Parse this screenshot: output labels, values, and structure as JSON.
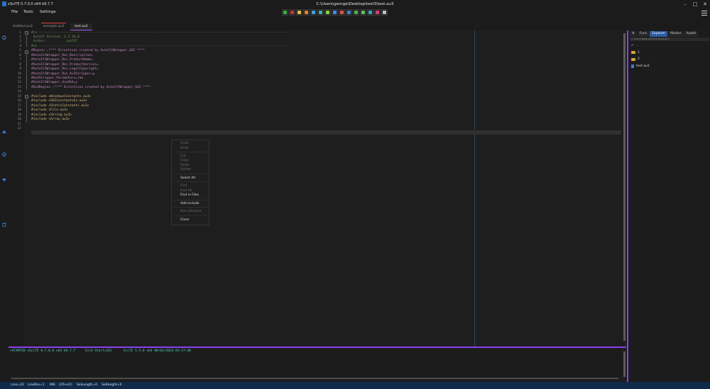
{
  "window": {
    "app_title": "xSciTE 0.7.0.0 x64 b9.7.7",
    "title": "C:\\Users\\george\\Desktop\\test3\\test.au3"
  },
  "menu": [
    "File",
    "Tools",
    "Settings"
  ],
  "toolbar": {
    "icons": [
      {
        "name": "run-icon",
        "color": "#3cb043"
      },
      {
        "name": "stop-icon",
        "color": "#d03030"
      },
      {
        "name": "compile-icon",
        "color": "#e0c040"
      },
      {
        "name": "build-icon",
        "color": "#e08030"
      },
      {
        "name": "tidy-icon",
        "color": "#40a0e0"
      },
      {
        "name": "syntax-check-icon",
        "color": "#40b0b0"
      },
      {
        "name": "koda-icon",
        "color": "#8ad040"
      },
      {
        "name": "info-icon",
        "color": "#4090e0"
      },
      {
        "name": "au3info-icon",
        "color": "#e05050"
      },
      {
        "name": "help-icon",
        "color": "#4080d0"
      },
      {
        "name": "find-icon",
        "color": "#50b050"
      },
      {
        "name": "ok-icon",
        "color": "#60c060"
      },
      {
        "name": "chart-icon",
        "color": "#40a0c0"
      },
      {
        "name": "table-icon",
        "color": "#d04080"
      },
      {
        "name": "fullscreen-icon",
        "color": "#c0c0c0"
      }
    ]
  },
  "tabs": [
    {
      "label": "Untitled.au3",
      "modified": false,
      "active": false
    },
    {
      "label": "example.au3",
      "modified": true,
      "active": false
    },
    {
      "label": "test.au3",
      "modified": false,
      "active": true
    }
  ],
  "editor": {
    "lines": [
      {
        "n": "1",
        "text": "#cs ----------------------------------------------------------------------------------------------------------------------------------",
        "cls": "c-comment"
      },
      {
        "n": "2",
        "text": " AutoIt Version: 3.3.16.0",
        "cls": "c-comment"
      },
      {
        "n": "3",
        "text": " Author:          ioa747",
        "cls": "c-comment"
      },
      {
        "n": "4",
        "text": "#ce ----------------------------------------------------------------------------------------------------------------------------------",
        "cls": "c-comment"
      },
      {
        "n": "5",
        "text": "#Region ;**** Directives created by AutoIt3Wrapper_GUI ****",
        "cls": "c-directive"
      },
      {
        "n": "6",
        "text": "#AutoIt3Wrapper_Res_Description=",
        "cls": "c-directive"
      },
      {
        "n": "7",
        "text": "#AutoIt3Wrapper_Res_ProductName=",
        "cls": "c-directive"
      },
      {
        "n": "8",
        "text": "#AutoIt3Wrapper_Res_ProductVersion=",
        "cls": "c-directive"
      },
      {
        "n": "9",
        "text": "#AutoIt3Wrapper_Res_LegalCopyright=",
        "cls": "c-directive"
      },
      {
        "n": "10",
        "text": "#AutoIt3Wrapper_Run_Au3Stripper=y",
        "cls": "c-directive"
      },
      {
        "n": "11",
        "text": "#Au3Stripper_Parameters=/mo",
        "cls": "c-directive"
      },
      {
        "n": "12",
        "text": "#AutoIt3Wrapper_UseX64=y",
        "cls": "c-directive"
      },
      {
        "n": "13",
        "text": "#EndRegion ;**** Directives created by AutoIt3Wrapper_GUI ****",
        "cls": "c-directive"
      },
      {
        "n": "14",
        "text": "",
        "cls": "c-kw"
      },
      {
        "n": "15",
        "text": "#include <WindowsConstants.au3>",
        "cls": "c-inc"
      },
      {
        "n": "16",
        "text": "#include <GUIConstantsEx.au3>",
        "cls": "c-inc"
      },
      {
        "n": "17",
        "text": "#include <StaticConstants.au3>",
        "cls": "c-inc"
      },
      {
        "n": "18",
        "text": "#include <File.au3>",
        "cls": "c-inc"
      },
      {
        "n": "19",
        "text": "#include <String.au3>",
        "cls": "c-inc"
      },
      {
        "n": "20",
        "text": "#include <Array.au3>",
        "cls": "c-inc"
      },
      {
        "n": "21",
        "text": "",
        "cls": "c-kw"
      },
      {
        "n": "22",
        "text": "",
        "cls": "c-kw"
      }
    ]
  },
  "context_menu": {
    "items": [
      {
        "label": "Undo",
        "enabled": false
      },
      {
        "label": "Redo",
        "enabled": false
      },
      {
        "label": "Cut",
        "enabled": false
      },
      {
        "label": "Copy",
        "enabled": false
      },
      {
        "label": "Paste",
        "enabled": false
      },
      {
        "label": "Delete",
        "enabled": false
      },
      {
        "label": "Select All",
        "enabled": true
      },
      {
        "label": "Find",
        "enabled": false
      },
      {
        "label": "Find All",
        "enabled": false
      },
      {
        "label": "Find in Files",
        "enabled": true
      },
      {
        "label": "Add include",
        "enabled": true
      },
      {
        "label": "Run selected",
        "enabled": false
      },
      {
        "label": "Close",
        "enabled": true
      }
    ]
  },
  "output": {
    "text": ">STARTED xSciTE 0.7.0.0 x64 b9.7.7     Cold Start=452      SciTE 5.5.0 x64 08/03/2024 03:17:40"
  },
  "right_panel": {
    "tabs": [
      "Func",
      "Explorer",
      "Marker",
      "Autoit"
    ],
    "active_tab": "Explorer",
    "path": "C:\\Users\\george\\Desktop\\test3",
    "entries": [
      {
        "type": "up",
        "label": ".."
      },
      {
        "type": "folder",
        "label": "1"
      },
      {
        "type": "folder",
        "label": "2"
      },
      {
        "type": "file",
        "label": "test.au3"
      }
    ]
  },
  "status": {
    "line": "Line=22",
    "linepos": "LinePos=1",
    "mode": "INS",
    "eol": "(CR+LF)",
    "sellength": "SelLength=0",
    "selheight": "SelHeight=0"
  },
  "colors": {
    "accent": "#8a3ff0",
    "statusbar": "#0f2a4a",
    "explorer_active_tab": "#2c5ba3"
  }
}
